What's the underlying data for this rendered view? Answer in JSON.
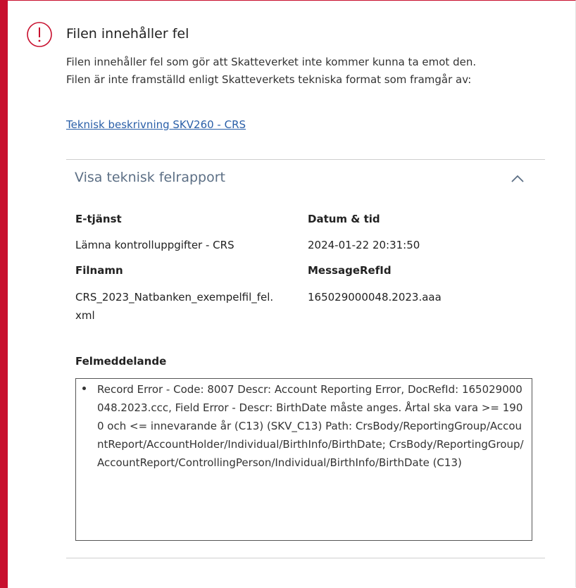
{
  "alert": {
    "icon": "exclamation-circle-icon",
    "title": "Filen innehåller fel",
    "line1": "Filen innehåller fel som gör att Skatteverket inte kommer kunna ta emot den.",
    "line2": "Filen är inte framställd enligt Skatteverkets tekniska format som framgår av:",
    "link": "Teknisk beskrivning SKV260 - CRS"
  },
  "accordion": {
    "label": "Visa teknisk felrapport",
    "icon": "chevron-up-icon",
    "expanded": true
  },
  "details": {
    "etjanst_label": "E-tjänst",
    "etjanst_value": "Lämna kontrolluppgifter - CRS",
    "datum_label": "Datum & tid",
    "datum_value": "2024-01-22 20:31:50",
    "filnamn_label": "Filnamn",
    "filnamn_value_1": "CRS_2023_Natbanken_exempelfil_fel.",
    "filnamn_value_2": "xml",
    "msgref_label": "MessageRefId",
    "msgref_value": "165029000048.2023.aaa"
  },
  "error": {
    "label": "Felmeddelande",
    "message": "Record Error - Code: 8007 Descr: Account Reporting Error, DocRefId: 165029000048.2023.ccc, Field Error - Descr: BirthDate måste anges. Årtal ska vara >= 1900 och <= innevarande år (C13) (SKV_C13) Path: CrsBody/ReportingGroup/AccountReport/AccountHolder/Individual/BirthInfo/BirthDate; CrsBody/ReportingGroup/AccountReport/ControllingPerson/Individual/BirthInfo/BirthDate (C13)"
  },
  "colors": {
    "accent": "#c8102e",
    "link": "#2a5fa8",
    "accordion_label": "#5c6f85"
  }
}
